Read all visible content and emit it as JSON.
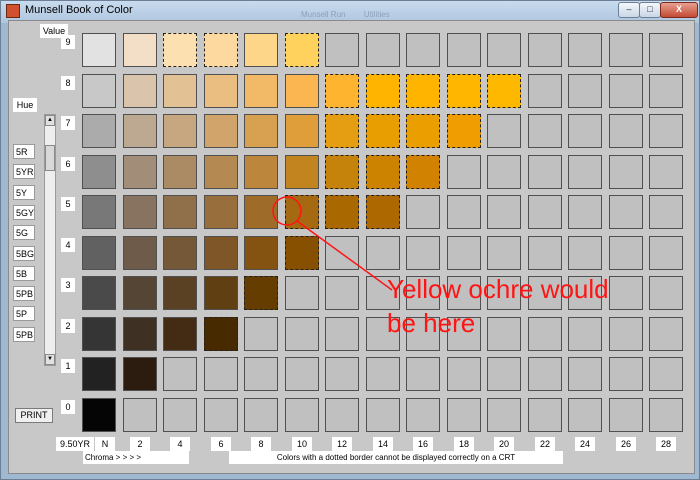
{
  "window": {
    "title": "Munsell Book of Color",
    "background_tabs": [
      "Munsell Run",
      "Utilities"
    ],
    "controls": {
      "minimize": "–",
      "maximize": "□",
      "close": "X"
    }
  },
  "value_header": "Value",
  "value_labels": [
    "9",
    "8",
    "7",
    "6",
    "5",
    "4",
    "3",
    "2",
    "1",
    "0"
  ],
  "hue_label": "Hue",
  "hues": [
    "5R",
    "5YR",
    "5Y",
    "5GY",
    "5G",
    "5BG",
    "5B",
    "5PB",
    "5P",
    "5PB"
  ],
  "scroll_arrows": {
    "up": "▲",
    "down": "▼"
  },
  "print_label": "PRINT",
  "current_hue": "9.50YR",
  "chroma_labels": [
    "N",
    "2",
    "4",
    "6",
    "8",
    "10",
    "12",
    "14",
    "16",
    "18",
    "20",
    "22",
    "24",
    "26",
    "28"
  ],
  "chroma_caption": "Chroma > > > >",
  "footer_note": "Colors with a dotted border cannot be displayed correctly on a CRT",
  "annotation": {
    "line1": "Yellow ochre would",
    "line2": "be here",
    "color": "#ff1414"
  },
  "grid": {
    "empty_color": "#c0c0c0",
    "rows": [
      {
        "value": "9",
        "cells": [
          {
            "c": "#e2e2e2"
          },
          {
            "c": "#f3dfc8"
          },
          {
            "c": "#fce0b0",
            "d": 1
          },
          {
            "c": "#fdd9a0",
            "d": 1
          },
          {
            "c": "#fed68a"
          },
          {
            "c": "#ffd15d",
            "d": 1
          }
        ]
      },
      {
        "value": "8",
        "cells": [
          {
            "c": "#c8c8c8"
          },
          {
            "c": "#dac4ab"
          },
          {
            "c": "#e2c295"
          },
          {
            "c": "#eabd80"
          },
          {
            "c": "#f2b966"
          },
          {
            "c": "#fcb651"
          },
          {
            "c": "#ffb42f",
            "d": 1
          },
          {
            "c": "#ffb400",
            "d": 1
          },
          {
            "c": "#ffb500",
            "d": 1
          },
          {
            "c": "#ffb600",
            "d": 1
          },
          {
            "c": "#ffb800",
            "d": 1
          }
        ]
      },
      {
        "value": "7",
        "cells": [
          {
            "c": "#ababab"
          },
          {
            "c": "#bda992"
          },
          {
            "c": "#c7a77f"
          },
          {
            "c": "#d1a46b"
          },
          {
            "c": "#d8a152"
          },
          {
            "c": "#e09e3b"
          },
          {
            "c": "#e59d12",
            "d": 1
          },
          {
            "c": "#e89e00",
            "d": 1
          },
          {
            "c": "#eb9e00",
            "d": 1
          },
          {
            "c": "#ef9d00",
            "d": 1
          }
        ]
      },
      {
        "value": "6",
        "cells": [
          {
            "c": "#8e8e8e"
          },
          {
            "c": "#a28e78"
          },
          {
            "c": "#ab8b64"
          },
          {
            "c": "#b58a52"
          },
          {
            "c": "#bc873d"
          },
          {
            "c": "#c2841f"
          },
          {
            "c": "#c6830c",
            "d": 1
          },
          {
            "c": "#cb8300",
            "d": 1
          },
          {
            "c": "#d08200",
            "d": 1
          }
        ]
      },
      {
        "value": "5",
        "cells": [
          {
            "c": "#787878"
          },
          {
            "c": "#87735f"
          },
          {
            "c": "#8f704b"
          },
          {
            "c": "#986e3c"
          },
          {
            "c": "#9e6b29"
          },
          {
            "c": "#a56a11",
            "d": 1
          },
          {
            "c": "#a96800",
            "d": 1
          },
          {
            "c": "#ae6800",
            "d": 1
          }
        ]
      },
      {
        "value": "4",
        "cells": [
          {
            "c": "#616161"
          },
          {
            "c": "#6e5b49"
          },
          {
            "c": "#755838"
          },
          {
            "c": "#7e5627"
          },
          {
            "c": "#845312"
          },
          {
            "c": "#875000",
            "d": 1
          }
        ]
      },
      {
        "value": "3",
        "cells": [
          {
            "c": "#4a4a4a"
          },
          {
            "c": "#554535"
          },
          {
            "c": "#5b4124"
          },
          {
            "c": "#603f13"
          },
          {
            "c": "#663d00",
            "d": 1
          }
        ]
      },
      {
        "value": "2",
        "cells": [
          {
            "c": "#353535"
          },
          {
            "c": "#3e3023"
          },
          {
            "c": "#432c13"
          },
          {
            "c": "#472a00",
            "d": 1
          }
        ]
      },
      {
        "value": "1",
        "cells": [
          {
            "c": "#222222"
          },
          {
            "c": "#2c1c10"
          }
        ]
      },
      {
        "value": "0",
        "cells": [
          {
            "c": "#050505"
          }
        ]
      }
    ]
  }
}
